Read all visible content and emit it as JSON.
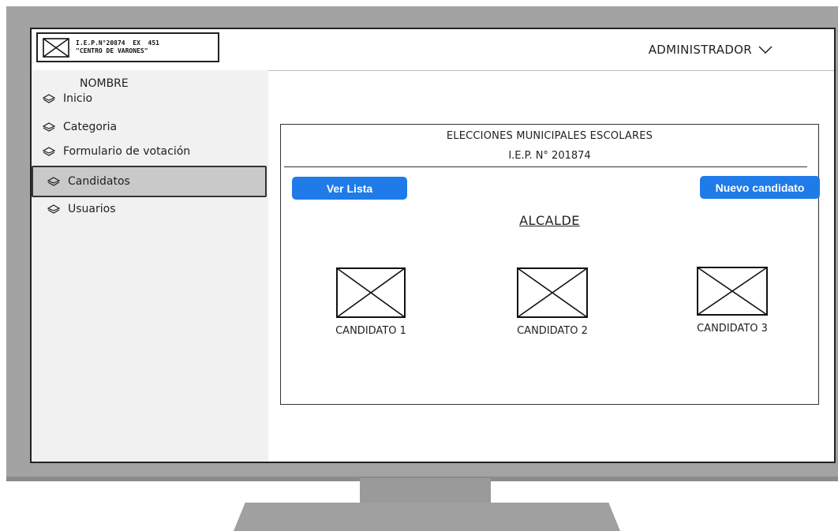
{
  "header": {
    "logo_line1": "I.E.P.N°20874  EX  451",
    "logo_line2": "\"CENTRO DE VARONES\"",
    "user_menu_label": "ADMINISTRADOR"
  },
  "sidebar": {
    "title": "NOMBRE",
    "items": [
      {
        "label": "Inicio"
      },
      {
        "label": "Categoria"
      },
      {
        "label": "Formulario de votación"
      },
      {
        "label": "Candidatos"
      },
      {
        "label": "Usuarios"
      }
    ],
    "active_item": "Candidatos"
  },
  "main": {
    "title": "ELECCIONES MUNICIPALES ESCOLARES",
    "subtitle": "I.E.P. N° 201874",
    "list_button": "Ver Lista",
    "new_button": "Nuevo candidato",
    "section_title": "ALCALDE",
    "candidates": [
      {
        "label": "CANDIDATO 1"
      },
      {
        "label": "CANDIDATO 2"
      },
      {
        "label": "CANDIDATO 3"
      }
    ]
  },
  "colors": {
    "accent": "#1f7be8",
    "monitor": "#a3a3a3",
    "sidebar_bg": "#f1f1f1",
    "active_bg": "#c9c9c9"
  }
}
